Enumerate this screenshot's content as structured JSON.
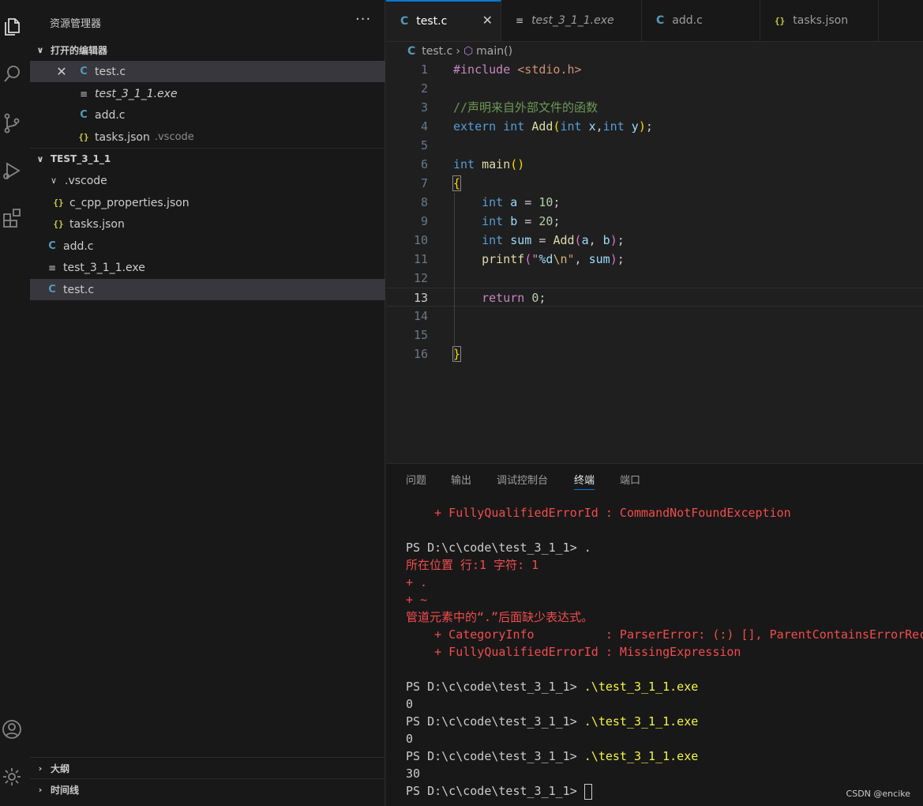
{
  "sidebar": {
    "title": "资源管理器",
    "more": "···",
    "open_editors": {
      "header": "打开的编辑器",
      "items": [
        {
          "icon": "C",
          "label": "test.c",
          "desc": ""
        },
        {
          "icon": "≡",
          "label": "test_3_1_1.exe",
          "desc": ""
        },
        {
          "icon": "C",
          "label": "add.c",
          "desc": ""
        },
        {
          "icon": "{}",
          "label": "tasks.json",
          "desc": ".vscode"
        }
      ]
    },
    "project": {
      "header": "TEST_3_1_1",
      "folder": ".vscode",
      "items": [
        {
          "icon": "{}",
          "label": "c_cpp_properties.json"
        },
        {
          "icon": "{}",
          "label": "tasks.json"
        },
        {
          "icon": "C",
          "label": "add.c"
        },
        {
          "icon": "≡",
          "label": "test_3_1_1.exe"
        },
        {
          "icon": "C",
          "label": "test.c"
        }
      ]
    },
    "outline": "大纲",
    "timeline": "时间线"
  },
  "tabs": [
    {
      "icon": "C",
      "label": "test.c"
    },
    {
      "icon": "≡",
      "label": "test_3_1_1.exe"
    },
    {
      "icon": "C",
      "label": "add.c"
    },
    {
      "icon": "{}",
      "label": "tasks.json"
    }
  ],
  "breadcrumb": {
    "file": "test.c",
    "symbol": "main()"
  },
  "code": {
    "line_numbers": [
      "1",
      "2",
      "3",
      "4",
      "5",
      "6",
      "7",
      "8",
      "9",
      "10",
      "11",
      "12",
      "13",
      "14",
      "15",
      "16"
    ],
    "current_line": "13"
  },
  "panel": {
    "tabs": [
      "问题",
      "输出",
      "调试控制台",
      "终端",
      "端口"
    ],
    "active_tab": "终端",
    "terminal": [
      {
        "text": "    + FullyQualifiedErrorId : CommandNotFoundException",
        "kind": "err"
      },
      {
        "text": "",
        "kind": "plain"
      },
      {
        "text": "PS D:\\c\\code\\test_3_1_1> .",
        "kind": "plain"
      },
      {
        "text": "所在位置 行:1 字符: 1",
        "kind": "err"
      },
      {
        "text": "+ .",
        "kind": "err"
      },
      {
        "text": "+ ~",
        "kind": "err"
      },
      {
        "text": "管道元素中的“.”后面缺少表达式。",
        "kind": "err"
      },
      {
        "text": "    + CategoryInfo          : ParserError: (:) [], ParentContainsErrorRec",
        "kind": "err"
      },
      {
        "text": "    + FullyQualifiedErrorId : MissingExpression",
        "kind": "err"
      },
      {
        "text": "",
        "kind": "plain"
      },
      {
        "prompt": "PS D:\\c\\code\\test_3_1_1> ",
        "cmd": ".\\test_3_1_1.exe",
        "kind": "cmd"
      },
      {
        "text": "0",
        "kind": "plain"
      },
      {
        "prompt": "PS D:\\c\\code\\test_3_1_1> ",
        "cmd": ".\\test_3_1_1.exe",
        "kind": "cmd"
      },
      {
        "text": "0",
        "kind": "plain"
      },
      {
        "prompt": "PS D:\\c\\code\\test_3_1_1> ",
        "cmd": ".\\test_3_1_1.exe",
        "kind": "cmd"
      },
      {
        "text": "30",
        "kind": "plain"
      },
      {
        "prompt": "PS D:\\c\\code\\test_3_1_1> ",
        "cmd": "",
        "kind": "cursor"
      }
    ]
  },
  "watermark": "CSDN @encike"
}
